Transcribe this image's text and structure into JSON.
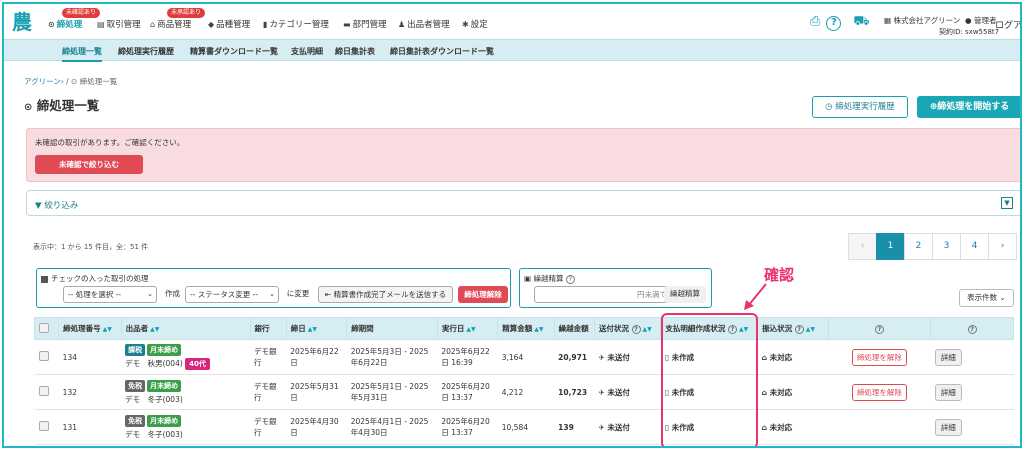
{
  "nav": {
    "logo": "農",
    "items": [
      {
        "label": "締処理",
        "icon": "check-circle-icon",
        "badge": "未確認あり",
        "active": true
      },
      {
        "label": "取引管理",
        "icon": "ledger-icon"
      },
      {
        "label": "商品管理",
        "icon": "basket-icon",
        "badge": "未承認あり"
      },
      {
        "label": "品種管理",
        "icon": "tag-icon"
      },
      {
        "label": "カテゴリー管理",
        "icon": "book-icon"
      },
      {
        "label": "部門管理",
        "icon": "folder-icon"
      },
      {
        "label": "出品者管理",
        "icon": "users-icon"
      },
      {
        "label": "設定",
        "icon": "gear-icon"
      }
    ],
    "company": "株式会社アグリーン",
    "role": "管理者",
    "contract": "契約ID: sxw558t7",
    "logout": "ログア"
  },
  "subnav": [
    "締処理一覧",
    "締処理実行履歴",
    "精算書ダウンロード一覧",
    "支払明細",
    "締日集計表",
    "締日集計表ダウンロード一覧"
  ],
  "breadcrumb": {
    "home": "アグリーン",
    "current": "締処理一覧"
  },
  "page_title": "締処理一覧",
  "buttons": {
    "history": "締処理実行履歴",
    "start": "締処理を開始する"
  },
  "alert": {
    "text": "未確認の取引があります。ご確認ください。",
    "button": "未確認で絞り込む"
  },
  "filter": {
    "label": "絞り込み"
  },
  "count": "表示中：1 から 15 件目，全：51 件",
  "pagination": [
    "‹",
    "1",
    "2",
    "3",
    "4",
    "›"
  ],
  "actions": {
    "title": "チェックの入った取引の処理",
    "select_process": "-- 処理を選択 --",
    "create": "作成",
    "select_status": "-- ステータス変更 --",
    "change": "に変更",
    "send_mail": "精算書作成完了メールを送信する",
    "release": "締処理解除"
  },
  "calc": {
    "title": "繰越精算",
    "placeholder": "円未満で",
    "button": "繰越精算"
  },
  "per_page": "表示件数",
  "annotation": "確認",
  "table": {
    "headers": [
      "締処理番号",
      "出品者",
      "銀行",
      "締日",
      "締期間",
      "実行日",
      "精算金額",
      "繰越金額",
      "送付状況",
      "支払明細作成状況",
      "振込状況",
      "",
      ""
    ],
    "rows": [
      {
        "id": "134",
        "tags": [
          "課税",
          "月末締め"
        ],
        "seller": "デモ　秋男(004)",
        "age": "40代",
        "bank": "デモ銀行",
        "closing": "2025年6月22日",
        "period": "2025年5月3日 - 2025年6月22日",
        "exec": "2025年6月22日 16:39",
        "amount": "3,164",
        "carry": "20,971",
        "send": "未送付",
        "statement": "未作成",
        "transfer": "未対応",
        "release": "締処理を解除",
        "detail": "詳細"
      },
      {
        "id": "132",
        "tags": [
          "免税",
          "月末締め"
        ],
        "seller": "デモ　冬子(003)",
        "age": "",
        "bank": "デモ銀行",
        "closing": "2025年5月31日",
        "period": "2025年5月1日 - 2025年5月31日",
        "exec": "2025年6月20日 13:37",
        "amount": "4,212",
        "carry": "10,723",
        "send": "未送付",
        "statement": "未作成",
        "transfer": "未対応",
        "release": "締処理を解除",
        "detail": "詳細"
      },
      {
        "id": "131",
        "tags": [
          "免税",
          "月末締め"
        ],
        "seller": "デモ　冬子(003)",
        "age": "",
        "bank": "デモ銀行",
        "closing": "2025年4月30日",
        "period": "2025年4月1日 - 2025年4月30日",
        "exec": "2025年6月20日 13:37",
        "amount": "10,584",
        "carry": "139",
        "send": "未送付",
        "statement": "未作成",
        "transfer": "未対応",
        "release": "",
        "detail": "詳細"
      }
    ]
  }
}
